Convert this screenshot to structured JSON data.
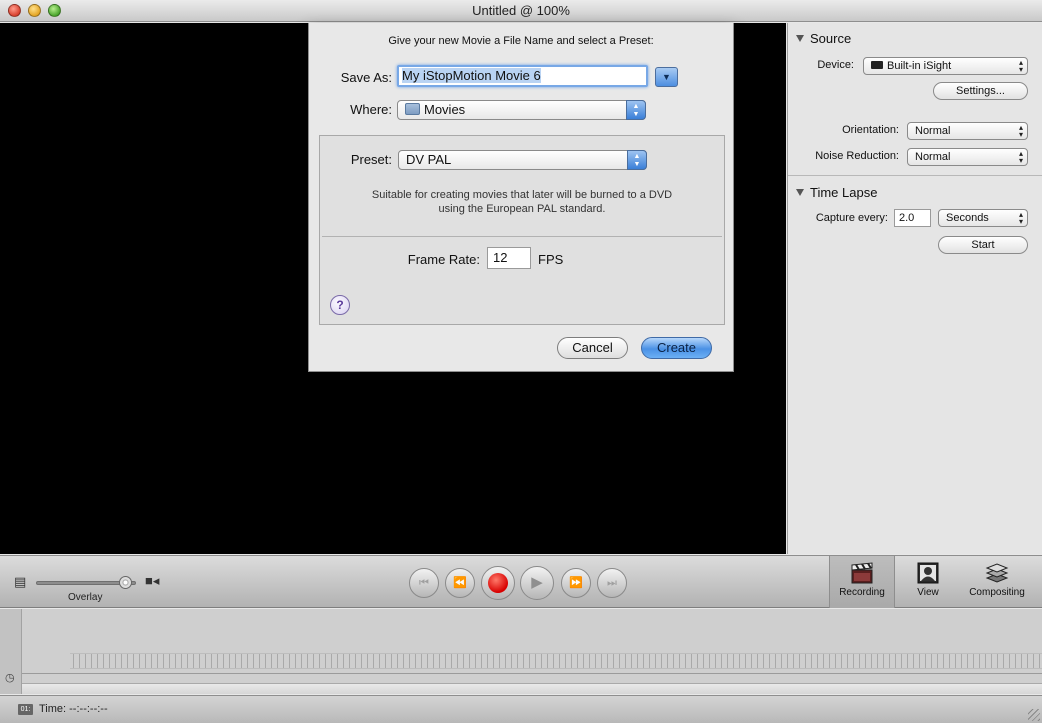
{
  "window": {
    "title": "Untitled @ 100%"
  },
  "sheet": {
    "prompt": "Give your new Movie a File Name and select a Preset:",
    "save_as_label": "Save As:",
    "save_as_value": "My iStopMotion Movie 6",
    "where_label": "Where:",
    "where_value": "Movies",
    "preset_label": "Preset:",
    "preset_value": "DV PAL",
    "preset_description_line1": "Suitable for creating movies that later will be burned to a DVD",
    "preset_description_line2": "using the European PAL standard.",
    "frame_rate_label": "Frame Rate:",
    "frame_rate_value": "12",
    "frame_rate_unit": "FPS",
    "help_label": "?",
    "cancel_label": "Cancel",
    "create_label": "Create"
  },
  "source": {
    "header": "Source",
    "device_label": "Device:",
    "device_value": "Built-in iSight",
    "settings_label": "Settings...",
    "orientation_label": "Orientation:",
    "orientation_value": "Normal",
    "noise_label": "Noise Reduction:",
    "noise_value": "Normal"
  },
  "time_lapse": {
    "header": "Time Lapse",
    "capture_label": "Capture every:",
    "capture_value": "2.0",
    "unit_value": "Seconds",
    "start_label": "Start"
  },
  "toolbar": {
    "overlay_label": "Overlay",
    "overlay_level": 0.95,
    "modes": [
      {
        "label": "Recording",
        "icon": "clapperboard-icon",
        "active": true
      },
      {
        "label": "View",
        "icon": "portrait-icon",
        "active": false
      },
      {
        "label": "Compositing",
        "icon": "layers-icon",
        "active": false
      }
    ]
  },
  "status": {
    "time_text": "Time: --:--:--:--",
    "timecode_icon_text": "01:"
  },
  "colors": {
    "accent": "#4a91e5",
    "record": "#d80000",
    "video_bg": "#000000"
  }
}
